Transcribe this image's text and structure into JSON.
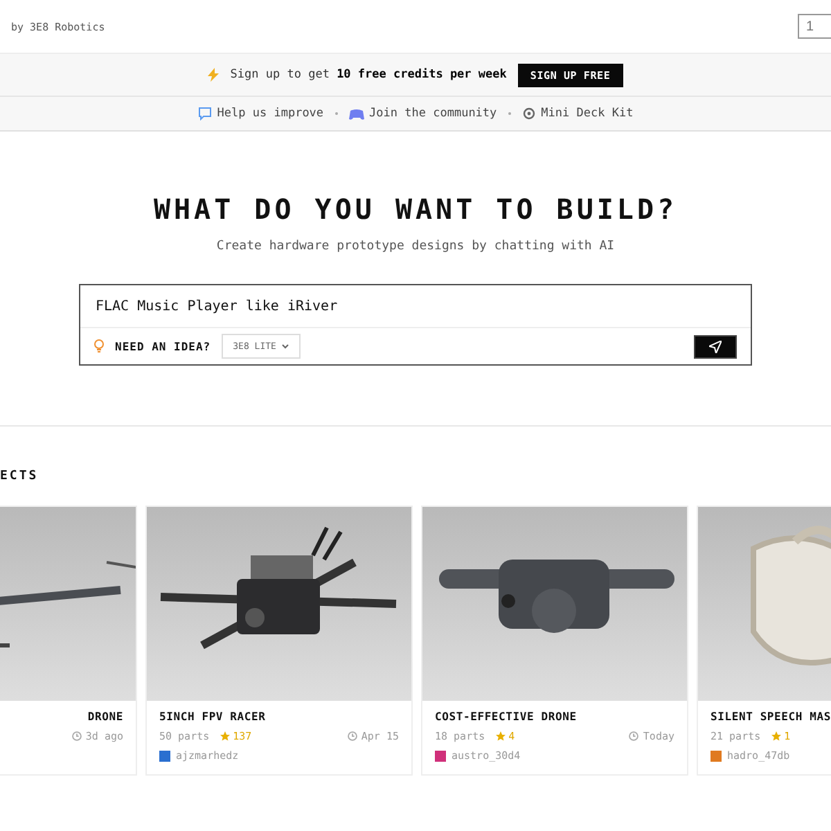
{
  "header": {
    "byline": "by 3E8 Robotics",
    "counter": "1"
  },
  "banner": {
    "text": "Sign up to get **10 free credits per week**",
    "button": "SIGN UP FREE"
  },
  "links": [
    {
      "kind": "feedback",
      "label": "Help us improve"
    },
    {
      "kind": "community",
      "label": "Join the community"
    },
    {
      "kind": "kit",
      "label": "Mini Deck Kit"
    }
  ],
  "hero": {
    "title": "WHAT DO YOU WANT TO BUILD?",
    "subtitle": "Create hardware prototype designs by chatting with AI"
  },
  "prompt": {
    "value": "FLAC Music Player like iRiver",
    "idea": "NEED AN IDEA?",
    "model": "3E8 LITE"
  },
  "section_title": "ECTS",
  "projects": [
    {
      "title": "DRONE",
      "date": "3d ago",
      "kind": "quad"
    },
    {
      "title": "5INCH FPV RACER",
      "parts": "50 parts",
      "stars": "137",
      "date": "Apr 15",
      "author": "ajzmarhedz",
      "color": "#2a6fd0",
      "kind": "fpv"
    },
    {
      "title": "COST-EFFECTIVE DRONE",
      "parts": "18 parts",
      "stars": "4",
      "date": "Today",
      "author": "austro_30d4",
      "color": "#d0307a",
      "kind": "mini"
    },
    {
      "title": "SILENT SPEECH MAS",
      "parts": "21 parts",
      "stars": "1",
      "author": "hadro_47db",
      "color": "#e07a20",
      "kind": "mask"
    }
  ]
}
